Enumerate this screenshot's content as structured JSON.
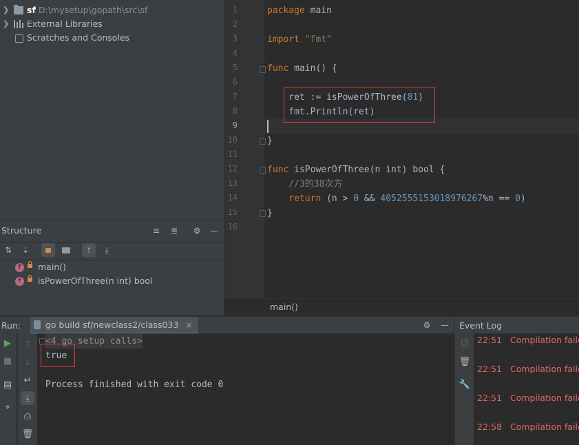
{
  "project_tree": {
    "items": [
      {
        "name": "sf",
        "path": "D:\\mysetup\\gopath\\src\\sf"
      },
      {
        "name": "External Libraries"
      },
      {
        "name": "Scratches and Consoles"
      }
    ]
  },
  "structure": {
    "title": "Structure",
    "items": [
      {
        "badge": "f",
        "label": "main()"
      },
      {
        "badge": "f",
        "label": "isPowerOfThree(n int) bool"
      }
    ]
  },
  "editor": {
    "line_numbers": [
      "1",
      "2",
      "3",
      "4",
      "5",
      "6",
      "7",
      "8",
      "9",
      "10",
      "11",
      "12",
      "13",
      "14",
      "15",
      "16"
    ],
    "current_line": "9",
    "lines": [
      {
        "kw": "package",
        "rest": " main"
      },
      {},
      {
        "kw": "import",
        "str": " \"fmt\""
      },
      {},
      {
        "kw": "func",
        "rest": " main() {"
      },
      {},
      {
        "text": "    ret := isPowerOfThree(",
        "num": "81",
        "tail": ")"
      },
      {
        "text": "    fmt.Println(ret)"
      },
      {},
      {
        "text": "}"
      },
      {},
      {
        "kw": "func",
        "rest": " isPowerOfThree(n int) bool {"
      },
      {
        "cmt": "    //3的38次方"
      },
      {
        "kw2": "    return",
        "a": " (n > ",
        "n1": "0",
        "b": " && ",
        "n2": "4052555153018976267",
        "c": "%n == ",
        "n3": "0",
        "d": ")"
      },
      {
        "text": "}"
      },
      {}
    ],
    "breadcrumb": "main()"
  },
  "run": {
    "label": "Run:",
    "tab": "go build sf/newclass2/class033",
    "tab_close": "×",
    "console": {
      "setup": "<4 go setup calls>",
      "output": "true",
      "finished": "Process finished with exit code 0"
    }
  },
  "event_log": {
    "title": "Event Log",
    "entries": [
      {
        "time": "22:51",
        "message": "Compilation failed"
      },
      {
        "time": "22:51",
        "message": "Compilation failed"
      },
      {
        "time": "22:51",
        "message": "Compilation failed"
      },
      {
        "time": "22:58",
        "message": "Compilation failed"
      }
    ]
  },
  "colors": {
    "keyword": "#cc7832",
    "string": "#6a8759",
    "number": "#6897bb",
    "comment": "#808080",
    "error": "#e06666",
    "highlight_box": "#e03b3b"
  }
}
